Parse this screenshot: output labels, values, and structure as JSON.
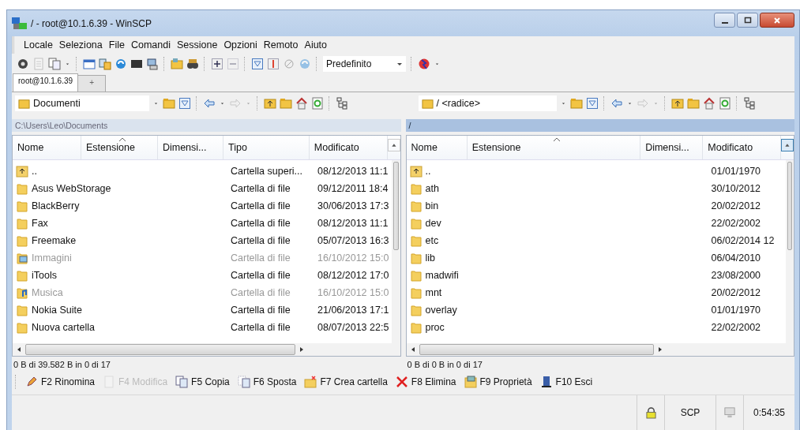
{
  "window": {
    "title": "/ - root@10.1.6.39 - WinSCP"
  },
  "menu": [
    "Locale",
    "Seleziona",
    "File",
    "Comandi",
    "Sessione",
    "Opzioni",
    "Remoto",
    "Aiuto"
  ],
  "toolbar": {
    "profile": "Predefinito"
  },
  "tabs": [
    {
      "label": "root@10.1.6.39",
      "selected": true
    },
    {
      "label": "+",
      "selected": false
    }
  ],
  "panels": [
    {
      "location": "Documenti",
      "path": "C:\\Users\\Leo\\Documents",
      "active": false,
      "columns": [
        {
          "label": "Nome",
          "sorted": false
        },
        {
          "label": "Estensione",
          "sorted": true
        },
        {
          "label": "Dimensi...",
          "sorted": false
        },
        {
          "label": "Tipo",
          "sorted": false
        },
        {
          "label": "Modificato",
          "sorted": false
        }
      ],
      "rows": [
        {
          "kind": "parent",
          "name": "..",
          "type": "Cartella superi...",
          "modified": "08/12/2013 11:1",
          "dimmed": false
        },
        {
          "kind": "folder",
          "name": "Asus WebStorage",
          "type": "Cartella di file",
          "modified": "09/12/2011 18:4",
          "dimmed": false
        },
        {
          "kind": "folder",
          "name": "BlackBerry",
          "type": "Cartella di file",
          "modified": "30/06/2013 17:3",
          "dimmed": false
        },
        {
          "kind": "folder",
          "name": "Fax",
          "type": "Cartella di file",
          "modified": "08/12/2013 11:1",
          "dimmed": false
        },
        {
          "kind": "folder",
          "name": "Freemake",
          "type": "Cartella di file",
          "modified": "05/07/2013 16:3",
          "dimmed": false
        },
        {
          "kind": "pictures",
          "name": "Immagini",
          "type": "Cartella di file",
          "modified": "16/10/2012 15:0",
          "dimmed": true
        },
        {
          "kind": "folder",
          "name": "iTools",
          "type": "Cartella di file",
          "modified": "08/12/2012 17:0",
          "dimmed": false
        },
        {
          "kind": "music",
          "name": "Musica",
          "type": "Cartella di file",
          "modified": "16/10/2012 15:0",
          "dimmed": true
        },
        {
          "kind": "folder",
          "name": "Nokia Suite",
          "type": "Cartella di file",
          "modified": "21/06/2013 17:1",
          "dimmed": false
        },
        {
          "kind": "folder",
          "name": "Nuova cartella",
          "type": "Cartella di file",
          "modified": "08/07/2013 22:5",
          "dimmed": false
        }
      ],
      "summary": "0 B di 39.582 B in 0 di 17"
    },
    {
      "location": "/ <radice>",
      "path": "/",
      "active": true,
      "columns": [
        {
          "label": "Nome",
          "sorted": false
        },
        {
          "label": "Estensione",
          "sorted": true
        },
        {
          "label": "Dimensi...",
          "sorted": false
        },
        {
          "label": "Modificato",
          "sorted": false
        }
      ],
      "rows": [
        {
          "kind": "parent",
          "name": "..",
          "modified": "01/01/1970",
          "dimmed": false
        },
        {
          "kind": "folder",
          "name": "ath",
          "modified": "30/10/2012",
          "dimmed": false
        },
        {
          "kind": "folder",
          "name": "bin",
          "modified": "20/02/2012",
          "dimmed": false
        },
        {
          "kind": "folder",
          "name": "dev",
          "modified": "22/02/2002",
          "dimmed": false
        },
        {
          "kind": "folder",
          "name": "etc",
          "modified": "06/02/2014 12",
          "dimmed": false
        },
        {
          "kind": "folder",
          "name": "lib",
          "modified": "06/04/2010",
          "dimmed": false
        },
        {
          "kind": "folder",
          "name": "madwifi",
          "modified": "23/08/2000",
          "dimmed": false
        },
        {
          "kind": "folder",
          "name": "mnt",
          "modified": "20/02/2012",
          "dimmed": false
        },
        {
          "kind": "folder",
          "name": "overlay",
          "modified": "01/01/1970",
          "dimmed": false
        },
        {
          "kind": "folder",
          "name": "proc",
          "modified": "22/02/2002",
          "dimmed": false
        }
      ],
      "summary": "0 B di 0 B in 0 di 17"
    }
  ],
  "function_keys": [
    {
      "label": "F2 Rinomina",
      "disabled": false
    },
    {
      "label": "F4 Modifica",
      "disabled": true
    },
    {
      "label": "F5 Copia",
      "disabled": false
    },
    {
      "label": "F6 Sposta",
      "disabled": false
    },
    {
      "label": "F7 Crea cartella",
      "disabled": false
    },
    {
      "label": "F8 Elimina",
      "disabled": false
    },
    {
      "label": "F9 Proprietà",
      "disabled": false
    },
    {
      "label": "F10 Esci",
      "disabled": false
    }
  ],
  "status_bar": {
    "protocol": "SCP",
    "time": "0:54:35"
  }
}
